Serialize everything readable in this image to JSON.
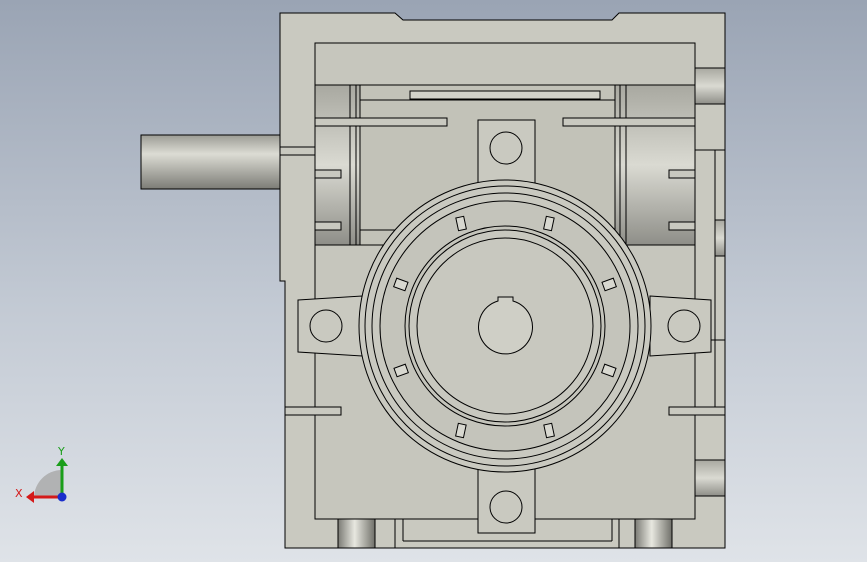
{
  "triad": {
    "y_label": "Y",
    "x_label": "X",
    "y_color": "#1a9e1a",
    "x_color": "#d41919",
    "z_color": "#1a2ecc"
  },
  "model": {
    "view": "front",
    "body_color": "#c9c9c0",
    "edge_color": "#000000",
    "shaft_color": "#b8b8b0"
  }
}
